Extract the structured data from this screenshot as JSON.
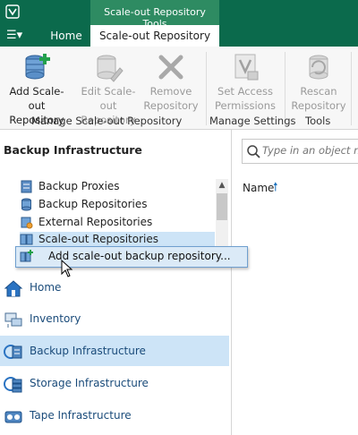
{
  "topbar": {
    "menu_label": "☰▾",
    "context_label": "Scale-out Repository Tools",
    "tabs": [
      {
        "label": "Home"
      },
      {
        "label": "Scale-out Repository"
      }
    ]
  },
  "ribbon": {
    "buttons": [
      {
        "label": "Add Scale-out\nRepository",
        "enabled": true
      },
      {
        "label": "Edit Scale-out\nRepository",
        "enabled": false
      },
      {
        "label": "Remove\nRepository",
        "enabled": false
      },
      {
        "label": "Set Access\nPermissions",
        "enabled": false
      },
      {
        "label": "Rescan\nRepository",
        "enabled": false
      }
    ],
    "groups": [
      {
        "label": "Manage  Scale-out Repository"
      },
      {
        "label": "Manage Settings"
      },
      {
        "label": "Tools"
      }
    ]
  },
  "left_pane": {
    "title": "Backup Infrastructure",
    "tree": [
      {
        "label": "Backup Proxies"
      },
      {
        "label": "Backup Repositories"
      },
      {
        "label": "External Repositories"
      },
      {
        "label": "Scale-out Repositories"
      }
    ],
    "context_item": "Add scale-out backup repository...",
    "nav": [
      {
        "label": "Home"
      },
      {
        "label": "Inventory"
      },
      {
        "label": "Backup Infrastructure"
      },
      {
        "label": "Storage Infrastructure"
      },
      {
        "label": "Tape Infrastructure"
      }
    ]
  },
  "right_pane": {
    "search_placeholder": "Type in an object name",
    "column_name": "Name",
    "sort_arrow": "🠕"
  },
  "colors": {
    "brand_green": "#0b6a4c",
    "selection": "#cde4f7",
    "link_blue": "#1a4b7a"
  }
}
